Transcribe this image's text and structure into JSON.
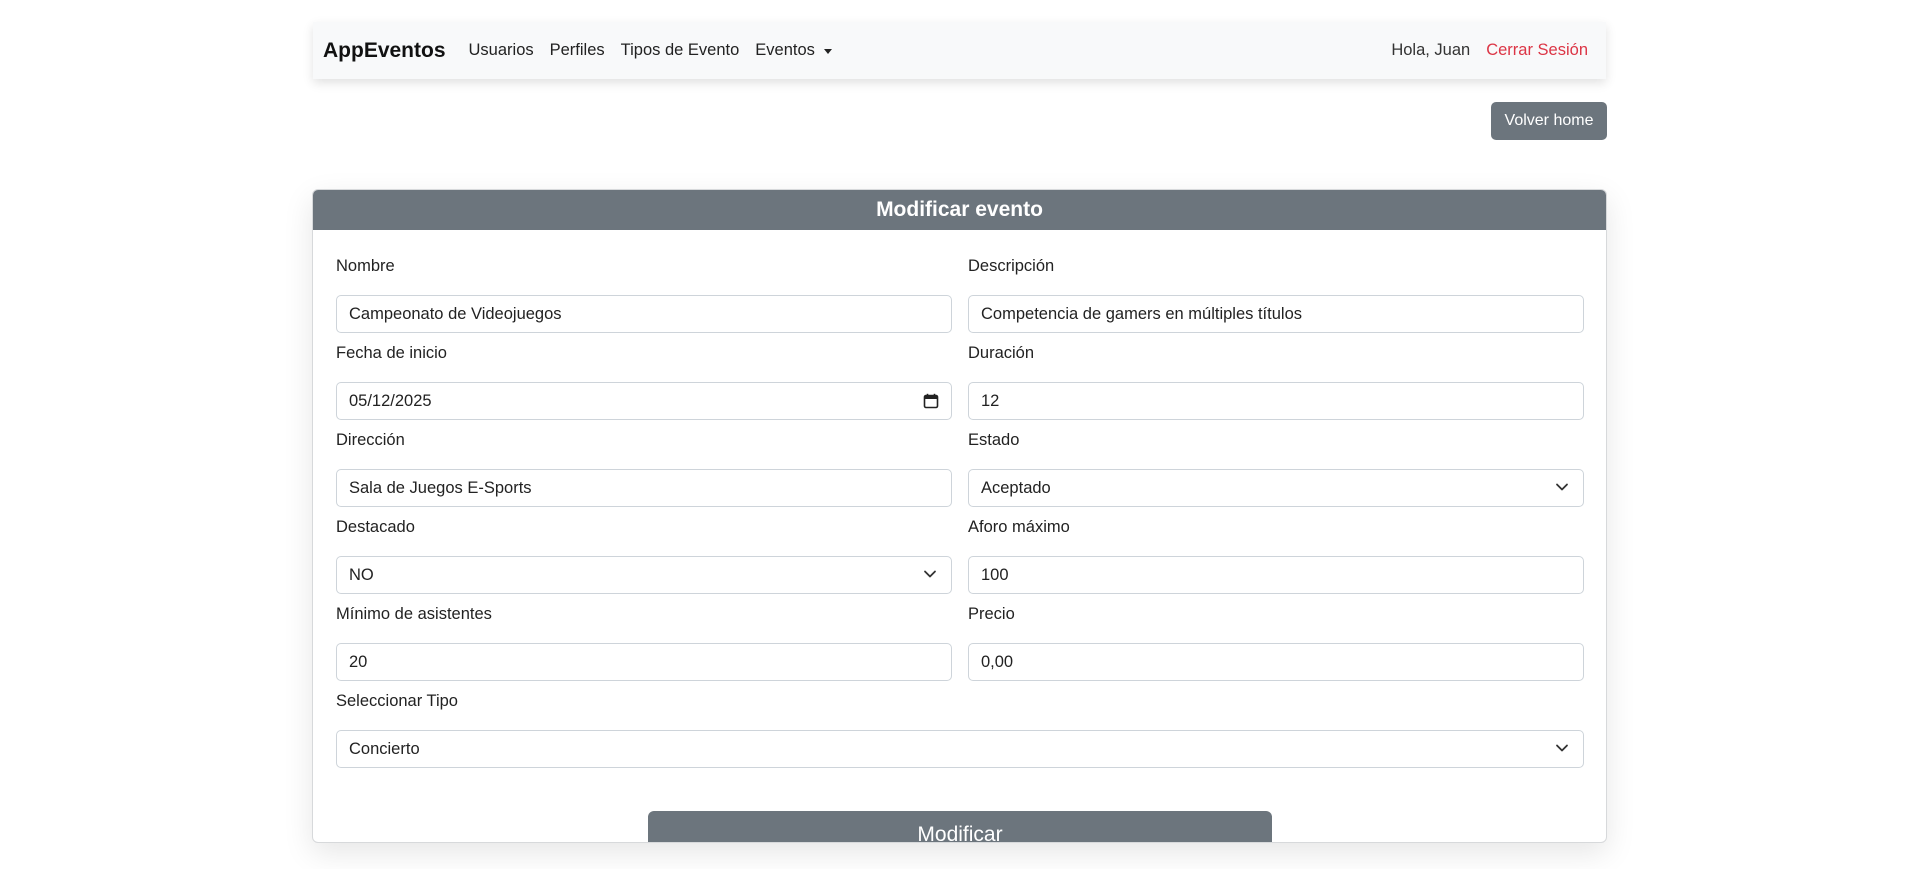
{
  "navbar": {
    "brand": "AppEventos",
    "links": [
      "Usuarios",
      "Perfiles",
      "Tipos de Evento",
      "Eventos"
    ],
    "greeting": "Hola, Juan",
    "logout": "Cerrar Sesión"
  },
  "back_button": "Volver home",
  "form": {
    "title": "Modificar evento",
    "nombre": {
      "label": "Nombre",
      "value": "Campeonato de Videojuegos"
    },
    "descripcion": {
      "label": "Descripción",
      "value": "Competencia de gamers en múltiples títulos"
    },
    "fecha_inicio": {
      "label": "Fecha de inicio",
      "value": "05/12/2025"
    },
    "duracion": {
      "label": "Duración",
      "value": "12"
    },
    "direccion": {
      "label": "Dirección",
      "value": "Sala de Juegos E-Sports"
    },
    "estado": {
      "label": "Estado",
      "value": "Aceptado"
    },
    "destacado": {
      "label": "Destacado",
      "value": "NO"
    },
    "aforo_maximo": {
      "label": "Aforo máximo",
      "value": "100"
    },
    "minimo_asistentes": {
      "label": "Mínimo de asistentes",
      "value": "20"
    },
    "precio": {
      "label": "Precio",
      "value": "0,00"
    },
    "tipo": {
      "label": "Seleccionar Tipo",
      "value": "Concierto"
    },
    "submit": "Modificar"
  },
  "colors": {
    "header_bg": "#6c757d",
    "button_bg": "#6c757d",
    "logout": "#dc3545",
    "navbar_bg": "#f8f9fa"
  },
  "icons": {
    "dropdown": "chevron-down-icon",
    "date": "calendar-icon",
    "nav_dropdown": "caret-down-icon"
  }
}
